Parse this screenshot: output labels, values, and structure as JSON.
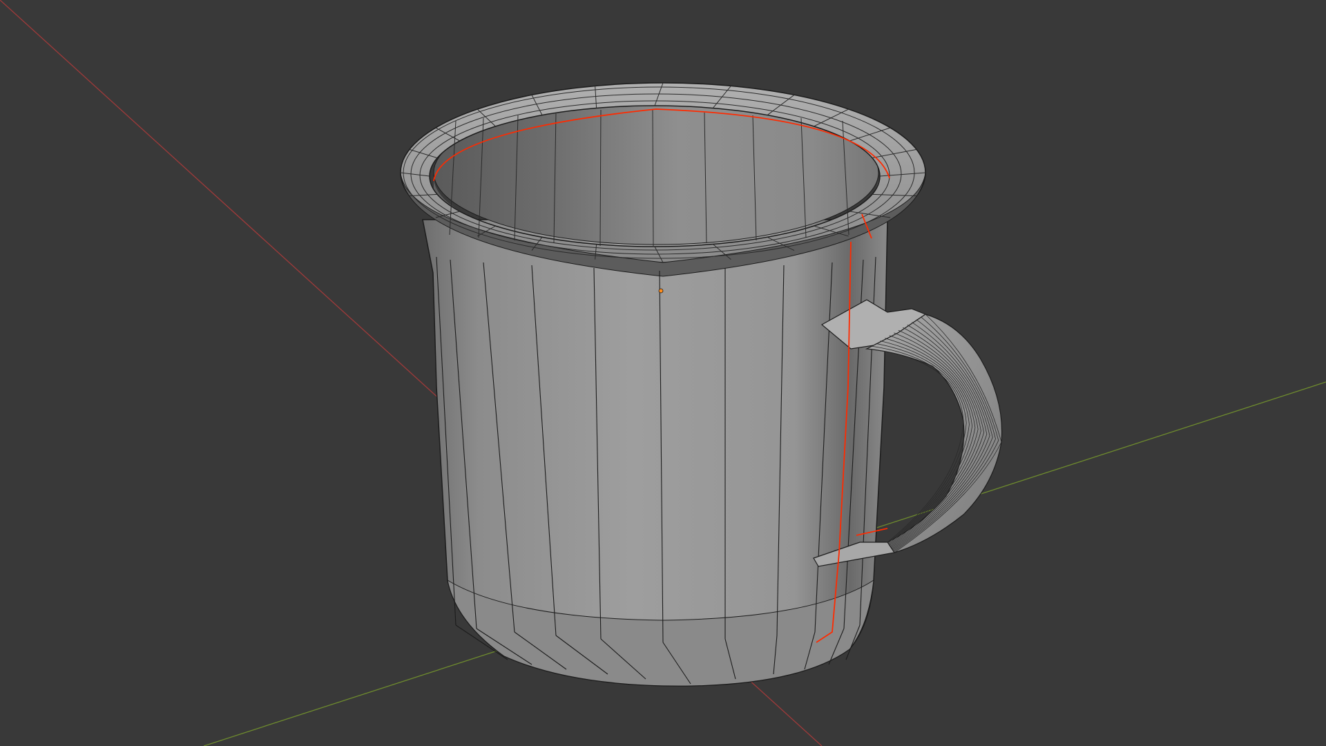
{
  "viewport": {
    "background_color": "#393939",
    "x_axis_color": "#a03a3a",
    "y_axis_color": "#6e8b2e",
    "seam_color": "#ff2a00",
    "origin_color": "#ff8c1a",
    "mesh_base_color": "#8f8f8f",
    "wire_color": "#1c1c1c"
  },
  "scene": {
    "object_name": "mug",
    "view_mode": "3d-viewport-solid-wireframe"
  }
}
